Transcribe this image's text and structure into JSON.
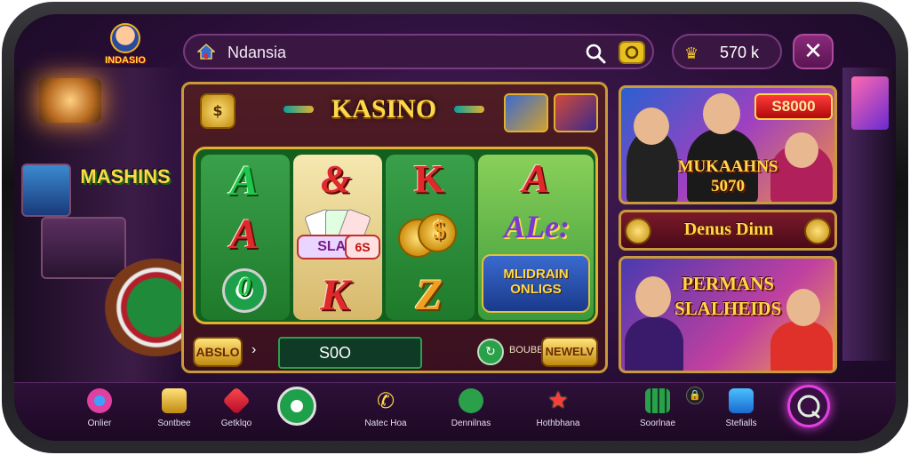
{
  "app": {
    "logo_text": "INDASIO",
    "search_label": "Ndansia",
    "coin_balance": "570 k"
  },
  "slot": {
    "title": "KASINO",
    "badge_symbol": "$",
    "reels": {
      "reel1": [
        "A",
        "A",
        "0"
      ],
      "reel2": [
        "&",
        "K"
      ],
      "reel3": [
        "K",
        "$",
        "Z"
      ],
      "reel4": [
        "A",
        "ALe:"
      ]
    },
    "mini_badge_1": "SLAD",
    "mini_badge_2": "6S",
    "multi_text": "MLIDRAIN ONLIGS",
    "bet_label": "ABSLO",
    "arrow_glyph": "›",
    "amount": "S0O",
    "bonus_label": "BOUBE",
    "new_button": "NEWELV"
  },
  "promos": {
    "promo1_title": "MUKAAHNS 5070",
    "promo1_tag": "S8000",
    "promo2_title": "Denus Dinn",
    "promo3_title": "PERMANS SLALHEIDS"
  },
  "left_sign": "MASHINS",
  "nav": {
    "items": [
      {
        "label": "Onlier"
      },
      {
        "label": "Sontbee"
      },
      {
        "label": "Getklqo"
      },
      {
        "label": ""
      },
      {
        "label": "Natec Hoa"
      },
      {
        "label": "Dennilnas"
      },
      {
        "label": "Hothbhana"
      },
      {
        "label": "Soorlnae"
      },
      {
        "label": "Stefialls"
      }
    ],
    "lock_glyph": "🔒"
  },
  "colors": {
    "background": "#2a0f38",
    "accent_gold": "#ffd84a",
    "accent_green": "#1ea04a",
    "accent_pink": "#e040e0"
  }
}
